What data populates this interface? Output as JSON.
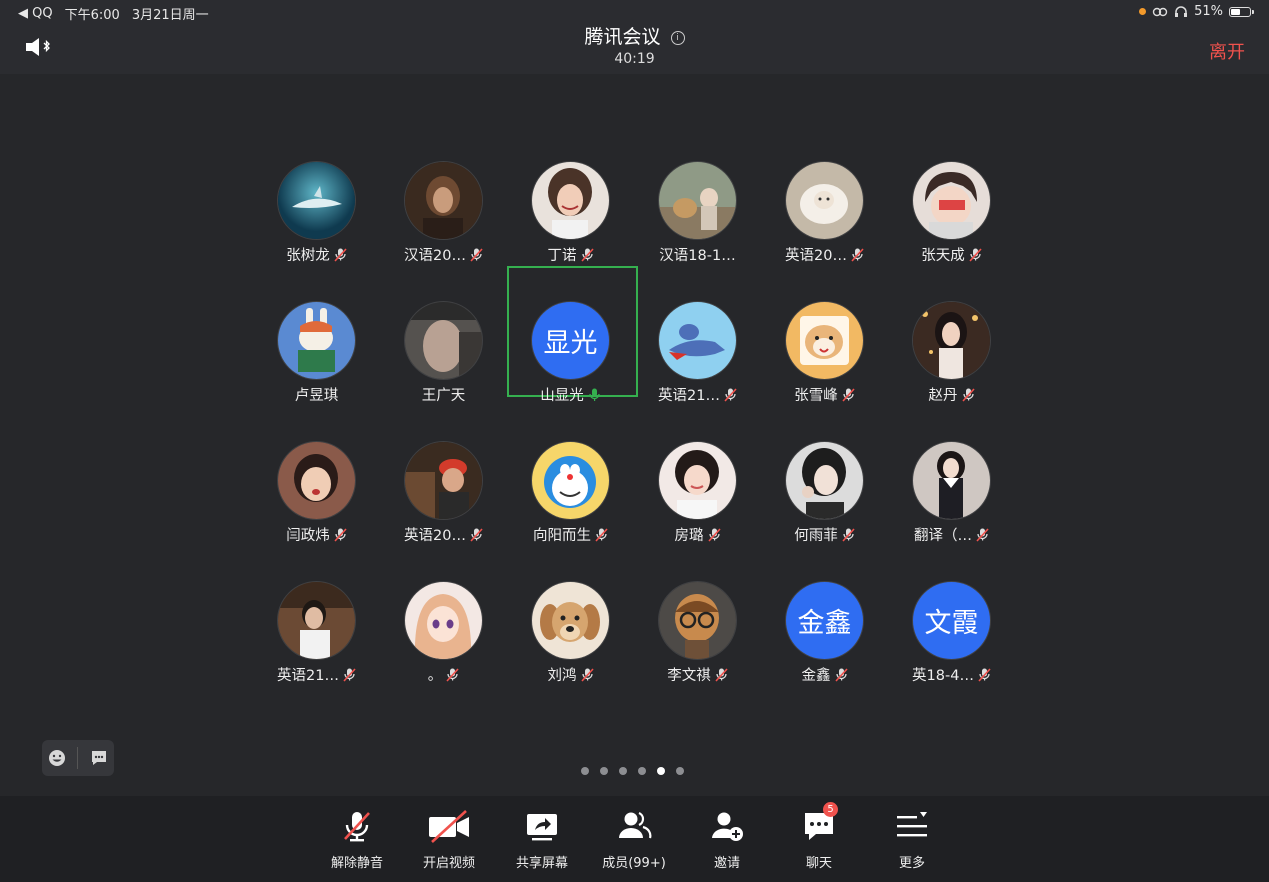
{
  "status_bar": {
    "back_app": "◀ QQ",
    "time": "下午6:00",
    "date": "3月21日周一",
    "battery": "51%",
    "battery_level": 0.51
  },
  "header": {
    "title": "腾讯会议",
    "timer": "40:19",
    "leave_label": "离开"
  },
  "participants": [
    {
      "name": "张树龙",
      "mic": "muted",
      "avatar": "photo-shark"
    },
    {
      "name": "汉语20…",
      "mic": "muted",
      "avatar": "photo-woman-dark"
    },
    {
      "name": "丁诺",
      "mic": "muted",
      "avatar": "photo-woman-laugh"
    },
    {
      "name": "汉语18-1…",
      "mic": "none",
      "avatar": "photo-dogs"
    },
    {
      "name": "英语20…",
      "mic": "muted",
      "avatar": "photo-sheep"
    },
    {
      "name": "张天成",
      "mic": "muted",
      "avatar": "photo-anime-boy"
    },
    {
      "name": "卢昱琪",
      "mic": "none",
      "avatar": "photo-toy-bunny"
    },
    {
      "name": "王广天",
      "mic": "none",
      "avatar": "photo-man-selfie"
    },
    {
      "name": "山显光",
      "mic": "active",
      "avatar": "text",
      "avatar_text": "显光"
    },
    {
      "name": "英语21…",
      "mic": "muted",
      "avatar": "photo-cartoon-cat"
    },
    {
      "name": "张雪峰",
      "mic": "muted",
      "avatar": "photo-shiba"
    },
    {
      "name": "赵丹",
      "mic": "muted",
      "avatar": "photo-girl-lights"
    },
    {
      "name": "闫政炜",
      "mic": "muted",
      "avatar": "photo-child"
    },
    {
      "name": "英语20…",
      "mic": "muted",
      "avatar": "photo-red-hat"
    },
    {
      "name": "向阳而生",
      "mic": "muted",
      "avatar": "photo-doraemon"
    },
    {
      "name": "房璐",
      "mic": "muted",
      "avatar": "photo-girl-smile"
    },
    {
      "name": "何雨菲",
      "mic": "muted",
      "avatar": "photo-girl-bw"
    },
    {
      "name": "翻译（…",
      "mic": "muted",
      "avatar": "photo-girl-uniform"
    },
    {
      "name": "英语21…",
      "mic": "muted",
      "avatar": "photo-man-cafe"
    },
    {
      "name": "。",
      "mic": "muted",
      "avatar": "photo-anime-girl"
    },
    {
      "name": "刘鸿",
      "mic": "muted",
      "avatar": "photo-puppy"
    },
    {
      "name": "李文祺",
      "mic": "muted",
      "avatar": "photo-cartoon-glasses"
    },
    {
      "name": "金鑫",
      "mic": "muted",
      "avatar": "text",
      "avatar_text": "金鑫"
    },
    {
      "name": "英18-4…",
      "mic": "muted",
      "avatar": "text",
      "avatar_text": "文霞"
    }
  ],
  "pagination": {
    "total": 6,
    "current": 5
  },
  "toolbar": {
    "unmute": "解除静音",
    "video": "开启视频",
    "share": "共享屏幕",
    "members": "成员(99+)",
    "invite": "邀请",
    "chat": "聊天",
    "chat_badge": "5",
    "more": "更多"
  },
  "colors": {
    "background": "#26272a",
    "leave": "#f0524d",
    "active_border": "#35b04f",
    "avatar_blue": "#2f6df2",
    "mic_muted_slash": "#f0524d",
    "mic_active": "#35b04f"
  }
}
